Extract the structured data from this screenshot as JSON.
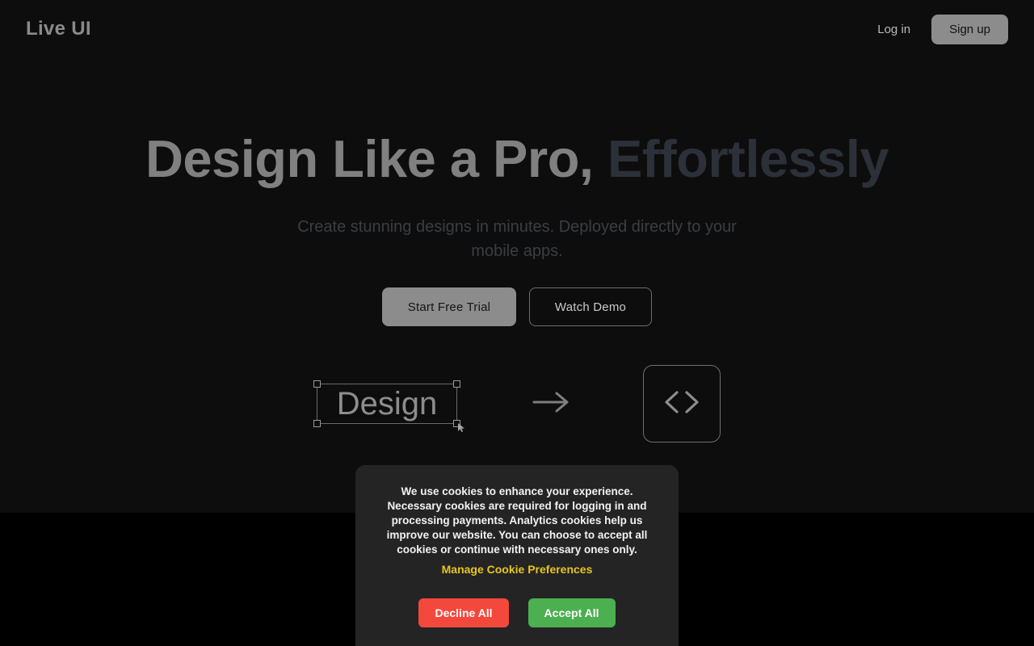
{
  "header": {
    "brand": "Live UI",
    "login_label": "Log in",
    "signup_label": "Sign up"
  },
  "hero": {
    "title_main": "Design Like a Pro,",
    "title_accent": "Effortlessly",
    "subtitle": "Create stunning designs in minutes. Deployed directly to your mobile apps.",
    "primary_cta": "Start Free Trial",
    "secondary_cta": "Watch Demo",
    "illustration": {
      "design_label": "Design",
      "arrow_glyph": "→",
      "code_glyph": "</>"
    }
  },
  "cookie_banner": {
    "body": "We use cookies to enhance your experience. Necessary cookies are required for logging in and processing payments. Analytics cookies help us improve our website. You can choose to accept all cookies or continue with necessary ones only.",
    "manage_label": "Manage Cookie Preferences",
    "decline_label": "Decline All",
    "accept_label": "Accept All"
  },
  "colors": {
    "page_background": "#000000",
    "hero_background": "#0d0d0d",
    "banner_background": "#242424",
    "title_main": "#808080",
    "title_accent": "#2c3039",
    "manage_link": "#e8c520",
    "decline": "#f4483c",
    "accept": "#4caf50"
  }
}
